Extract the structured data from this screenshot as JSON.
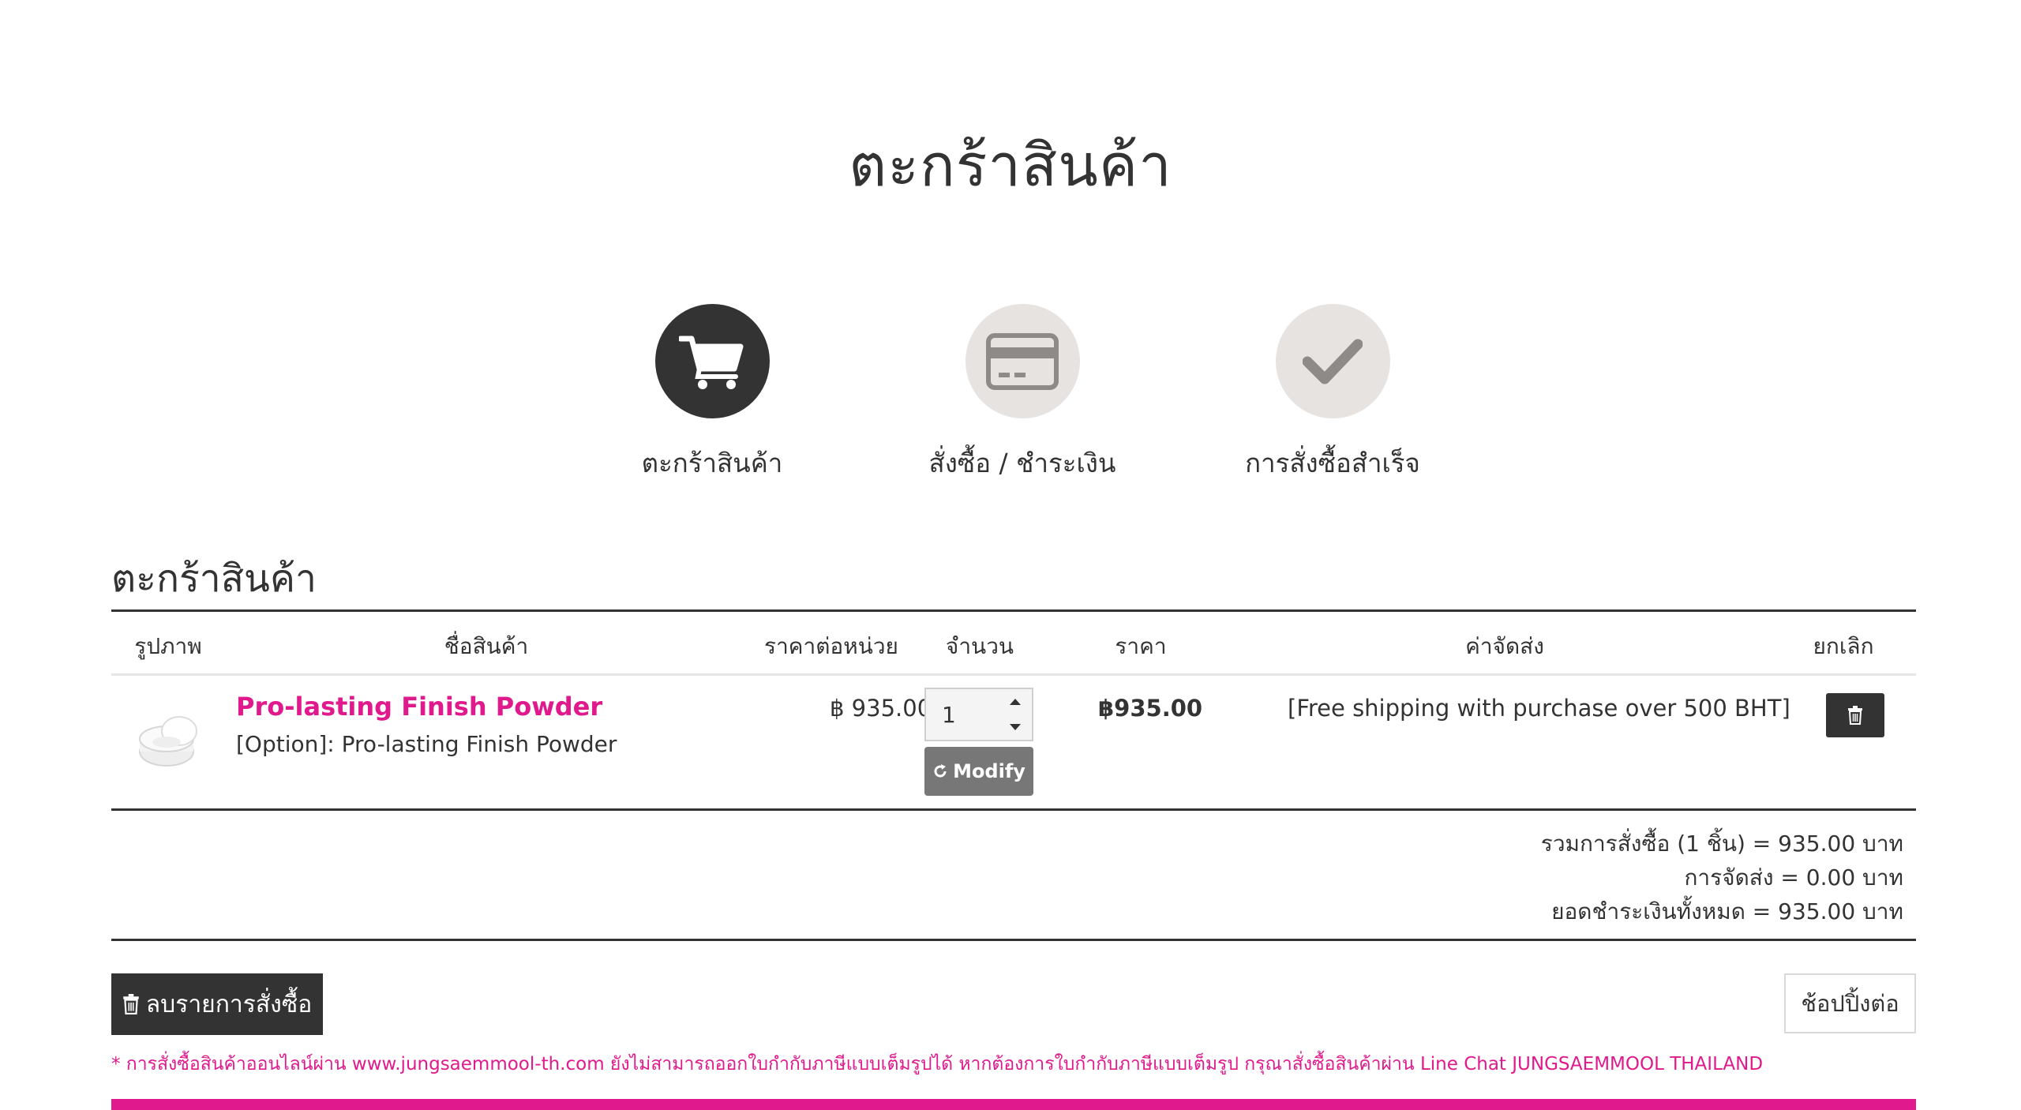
{
  "page": {
    "title": "ตะกร้าสินค้า"
  },
  "steps": [
    {
      "label": "ตะกร้าสินค้า",
      "icon": "cart-icon",
      "active": true
    },
    {
      "label": "สั่งซื้อ / ชำระเงิน",
      "icon": "credit-card-icon",
      "active": false
    },
    {
      "label": "การสั่งซื้อสำเร็จ",
      "icon": "check-icon",
      "active": false
    }
  ],
  "cart": {
    "section_title": "ตะกร้าสินค้า",
    "columns": [
      "รูปภาพ",
      "ชื่อสินค้า",
      "ราคาต่อหน่วย",
      "จำนวน",
      "ราคา",
      "ค่าจัดส่ง",
      "ยกเลิก"
    ],
    "items": [
      {
        "name": "Pro-lasting Finish Powder",
        "option": "[Option]: Pro-lasting Finish Powder",
        "unit_price": "฿ 935.00",
        "quantity": "1",
        "modify_label": "Modify",
        "price": "฿935.00",
        "shipping": "[Free shipping with purchase over 500 BHT]"
      }
    ],
    "summary": {
      "subtotal": "รวมการสั่งซื้อ (1 ชิ้น) = 935.00 บาท",
      "shipping": "การจัดส่ง = 0.00 บาท",
      "total": "ยอดชำระเงินทั้งหมด = 935.00 บาท"
    }
  },
  "actions": {
    "clear_label": "ลบรายการสั่งซื้อ",
    "continue_label": "ช้อปปิ้งต่อ"
  },
  "notice": "* การสั่งซื้อสินค้าออนไลน์ผ่าน www.jungsaemmool-th.com ยังไม่สามารถออกใบกำกับภาษีแบบเต็มรูปได้ หากต้องการใบกำกับภาษีแบบเต็มรูป กรุณาสั่งซื้อสินค้าผ่าน Line Chat JUNGSAEMMOOL THAILAND",
  "colors": {
    "accent": "#e01a8c",
    "dark": "#333333",
    "step_inactive": "#e6e3e1",
    "modify": "#777777"
  }
}
